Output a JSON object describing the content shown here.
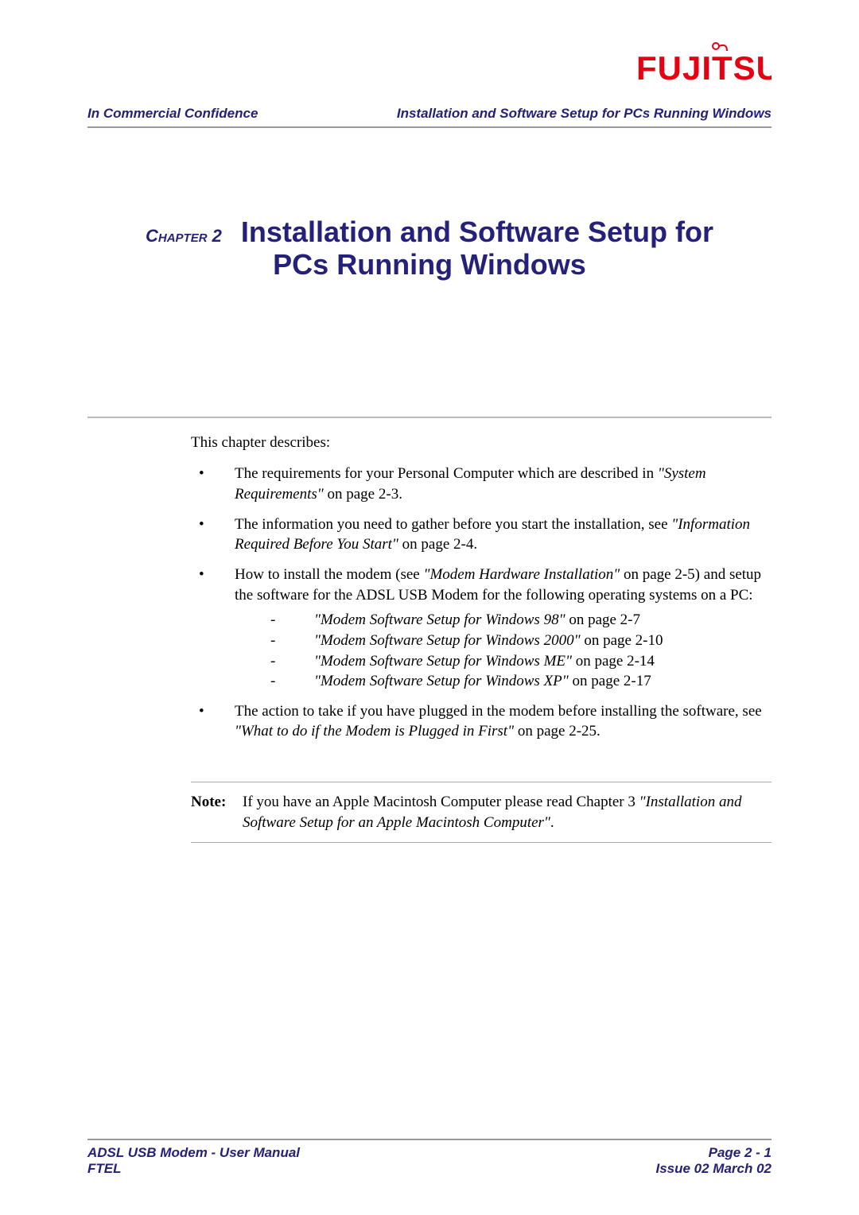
{
  "header": {
    "left": "In Commercial Confidence",
    "right": "Installation and Software Setup for PCs Running Windows"
  },
  "chapter": {
    "label": "Chapter 2",
    "title_line1": "Installation and Software Setup for",
    "title_line2": "PCs Running Windows"
  },
  "body": {
    "intro": "This chapter describes:",
    "bullets": [
      {
        "pre": "The requirements for your Personal Computer which are described in ",
        "ital": "\"System Requirements\"",
        "post": " on page 2-3."
      },
      {
        "pre": "The information you need to gather before you start the installation, see ",
        "ital": "\"Information Required Before You Start\"",
        "post": " on page 2-4."
      },
      {
        "pre": "How to install the modem (see ",
        "ital": "\"Modem Hardware Installation\"",
        "post": " on page 2-5) and setup the software for the ADSL USB Modem for the following operating systems on a PC:",
        "sub": [
          {
            "ital": "\"Modem Software Setup for Windows 98\"",
            "post": " on page 2-7"
          },
          {
            "ital": "\"Modem Software Setup for Windows 2000\"",
            "post": " on page 2-10"
          },
          {
            "ital": "\"Modem Software Setup for Windows ME\"",
            "post": " on page 2-14"
          },
          {
            "ital": "\"Modem Software Setup for Windows XP\"",
            "post": " on page 2-17"
          }
        ]
      },
      {
        "pre": "The action to take if you have plugged in the modem before installing the software, see ",
        "ital": "\"What to do if the Modem is Plugged in First\"",
        "post": " on page 2-25."
      }
    ],
    "note": {
      "label": "Note:",
      "pre": "If you have an Apple Macintosh Computer please read Chapter 3 ",
      "ital": "\"Installation and Software Setup for an Apple Macintosh Computer\"",
      "post": "."
    }
  },
  "footer": {
    "left1": "ADSL USB Modem - User Manual",
    "left2": "FTEL",
    "right1": "Page 2 - 1",
    "right2": "Issue 02 March 02"
  }
}
